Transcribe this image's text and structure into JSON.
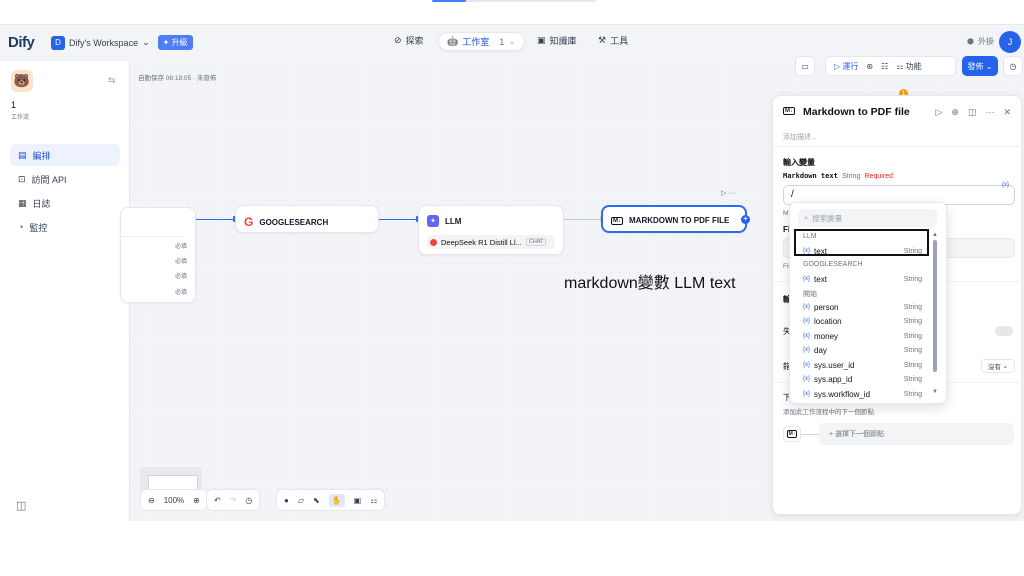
{
  "header": {
    "logo": "Dify",
    "workspace_initial": "D",
    "workspace_name": "Dify's Workspace",
    "upgrade": "升級",
    "nav": [
      {
        "label": "探索"
      },
      {
        "label": "工作室",
        "count": "1"
      },
      {
        "label": "知識庫"
      },
      {
        "label": "工具"
      }
    ],
    "plugins": "外掛",
    "user_initial": "J"
  },
  "sidebar": {
    "app_name": "1",
    "app_type": "工作流",
    "items": [
      {
        "label": "編排"
      },
      {
        "label": "訪問 API"
      },
      {
        "label": "日誌"
      },
      {
        "label": "監控"
      }
    ]
  },
  "canvas": {
    "autosave": "自動保存 08:18:05 · 未發佈",
    "start_rows": [
      "必填",
      "必填",
      "必填",
      "必填"
    ],
    "nodes": {
      "google": "GOOGLESEARCH",
      "llm": "LLM",
      "llm_model": "DeepSeek R1 Distill Ll...",
      "llm_mode": "CHAT",
      "md": "MARKDOWN TO PDF FILE"
    },
    "annotation": "markdown變數 LLM text",
    "zoom": "100%"
  },
  "toolbar_right": {
    "run": "運行",
    "features": "功能",
    "publish": "發佈",
    "badge": "1"
  },
  "panel": {
    "title": "Markdown to PDF file",
    "desc": "添加描述...",
    "input_vars": "輸入變量",
    "var_name": "Markdown text",
    "var_type": "String",
    "required": "Required",
    "var_tag": "{x}",
    "trunc_m": "M",
    "trunc_fi": "Fi",
    "trunc_fil": "Fil",
    "trunc_out": "輸",
    "trunc_fail": "失",
    "trunc_retry": "錯",
    "retry_value": "沒有",
    "next_step": "下",
    "next_desc": "添加此工作流程中的下一個節點",
    "next_btn": "+ 選擇下一個節點"
  },
  "dropdown": {
    "search_placeholder": "搜索變量",
    "groups": [
      {
        "name": "LLM",
        "vars": [
          {
            "name": "text",
            "type": "String"
          }
        ]
      },
      {
        "name": "GOOGLESEARCH",
        "vars": [
          {
            "name": "text",
            "type": "String"
          }
        ]
      },
      {
        "name": "開始",
        "vars": [
          {
            "name": "person",
            "type": "String"
          },
          {
            "name": "location",
            "type": "String"
          },
          {
            "name": "money",
            "type": "String"
          },
          {
            "name": "day",
            "type": "String"
          },
          {
            "name": "sys.user_id",
            "type": "String"
          },
          {
            "name": "sys.app_id",
            "type": "String"
          },
          {
            "name": "sys.workflow_id",
            "type": "String"
          }
        ]
      }
    ]
  },
  "colors": {
    "accent": "#2563eb",
    "edge": "#2f6bf0",
    "required": "#dc2626"
  }
}
